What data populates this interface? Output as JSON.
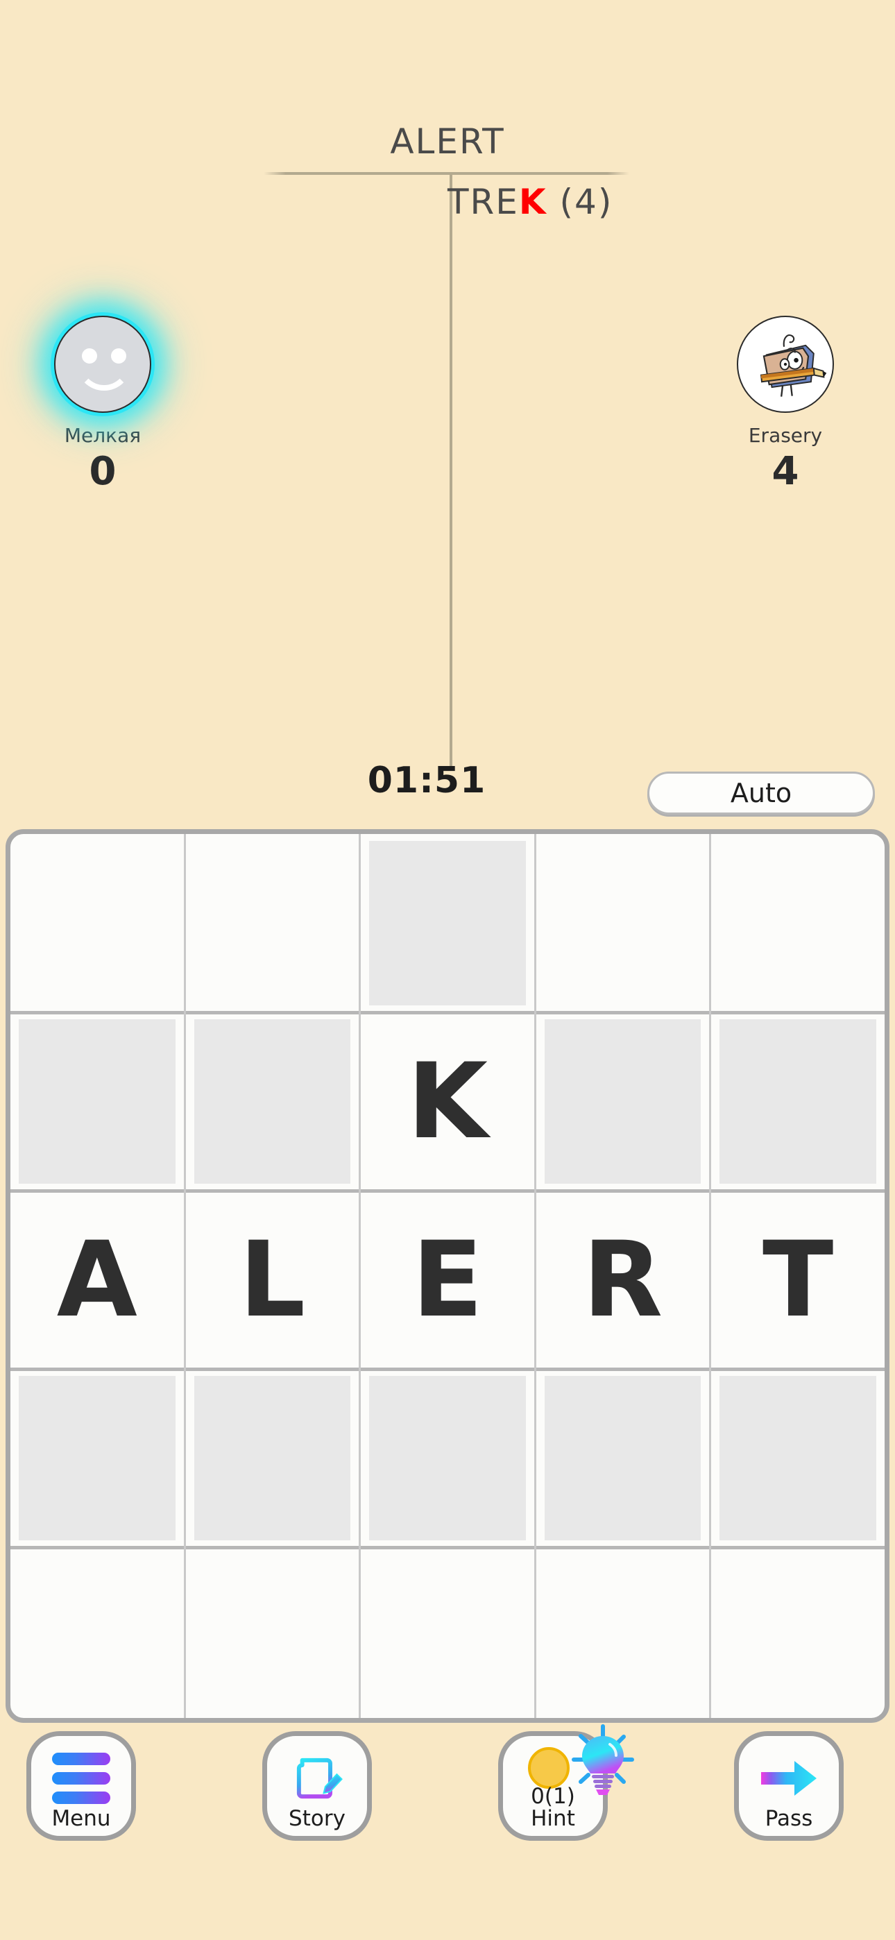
{
  "header": {
    "top_word": "ALERT",
    "bottom_prefix": "TRE",
    "bottom_highlight": "K",
    "bottom_suffix": " (4)",
    "highlight_color": "#ff0000"
  },
  "players": [
    {
      "name": "Мелкая",
      "score": "0",
      "avatar_type": "smiley-face",
      "active": true,
      "glow_color": "#2ce6f5"
    },
    {
      "name": "Erasery",
      "score": "4",
      "avatar_type": "eraser-mascot",
      "active": false
    }
  ],
  "status": {
    "timer": "01:51",
    "auto_label": "Auto"
  },
  "board": {
    "rows": 5,
    "cols": 5,
    "cells": [
      [
        {
          "letter": "",
          "filled": false
        },
        {
          "letter": "",
          "filled": false
        },
        {
          "letter": "",
          "filled": true
        },
        {
          "letter": "",
          "filled": false
        },
        {
          "letter": "",
          "filled": false
        }
      ],
      [
        {
          "letter": "",
          "filled": true
        },
        {
          "letter": "",
          "filled": true
        },
        {
          "letter": "K",
          "filled": false
        },
        {
          "letter": "",
          "filled": true
        },
        {
          "letter": "",
          "filled": true
        }
      ],
      [
        {
          "letter": "A",
          "filled": false
        },
        {
          "letter": "L",
          "filled": false
        },
        {
          "letter": "E",
          "filled": false
        },
        {
          "letter": "R",
          "filled": false
        },
        {
          "letter": "T",
          "filled": false
        }
      ],
      [
        {
          "letter": "",
          "filled": true
        },
        {
          "letter": "",
          "filled": true
        },
        {
          "letter": "",
          "filled": true
        },
        {
          "letter": "",
          "filled": true
        },
        {
          "letter": "",
          "filled": true
        }
      ],
      [
        {
          "letter": "",
          "filled": false
        },
        {
          "letter": "",
          "filled": false
        },
        {
          "letter": "",
          "filled": false
        },
        {
          "letter": "",
          "filled": false
        },
        {
          "letter": "",
          "filled": false
        }
      ]
    ]
  },
  "toolbar": {
    "menu_label": "Menu",
    "story_label": "Story",
    "hint_count": "0(1)",
    "hint_label": "Hint",
    "pass_label": "Pass"
  },
  "colors": {
    "background": "#f9e8c5",
    "board_bg": "#fcfcfa",
    "tile_filled": "#e8e8e8",
    "text": "#2f2f2f",
    "accent_blue": "#1f8ffa",
    "accent_purple": "#9b3df2",
    "accent_cyan": "#2ce6f5"
  }
}
